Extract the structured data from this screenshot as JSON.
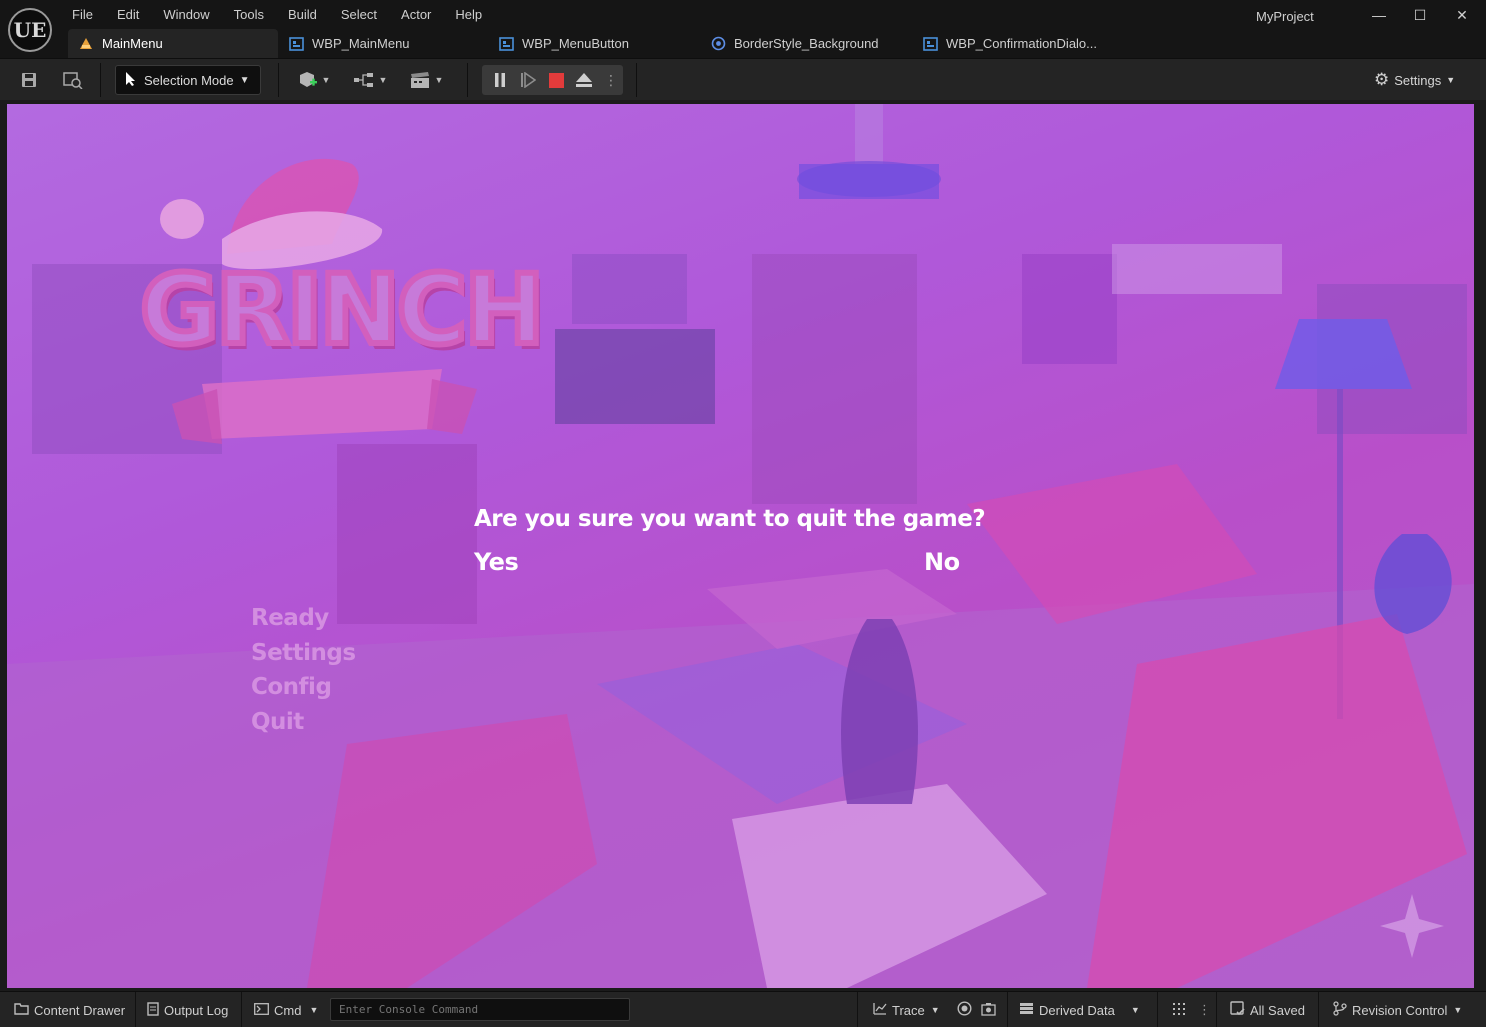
{
  "app": {
    "project": "MyProject",
    "logo": "UE"
  },
  "menu": [
    "File",
    "Edit",
    "Window",
    "Tools",
    "Build",
    "Select",
    "Actor",
    "Help"
  ],
  "window_controls": {
    "minimize": "—",
    "maximize": "☐",
    "close": "✕"
  },
  "tabs": [
    {
      "label": "MainMenu",
      "icon": "level-icon",
      "active": true
    },
    {
      "label": "WBP_MainMenu",
      "icon": "widget-blueprint-icon",
      "active": false
    },
    {
      "label": "WBP_MenuButton",
      "icon": "widget-blueprint-icon",
      "active": false
    },
    {
      "label": "BorderStyle_Background",
      "icon": "slate-brush-icon",
      "active": false
    },
    {
      "label": "WBP_ConfirmationDialo...",
      "icon": "widget-blueprint-icon",
      "active": false
    }
  ],
  "toolbar": {
    "selection_mode": "Selection Mode",
    "settings": "Settings"
  },
  "game": {
    "logo_text": "GRINCH",
    "dialog": {
      "question": "Are you sure you want to quit the game?",
      "yes": "Yes",
      "no": "No"
    },
    "main_menu": [
      "Ready",
      "Settings",
      "Config",
      "Quit"
    ]
  },
  "statusbar": {
    "content_drawer": "Content Drawer",
    "output_log": "Output Log",
    "cmd": "Cmd",
    "console_placeholder": "Enter Console Command",
    "trace": "Trace",
    "derived_data": "Derived Data",
    "all_saved": "All Saved",
    "revision_control": "Revision Control"
  },
  "colors": {
    "accent_orange": "#e8a13a",
    "widget_blue": "#4a90d9",
    "stop_red": "#e23b3b",
    "overlay_purple": "#b45fd6"
  }
}
